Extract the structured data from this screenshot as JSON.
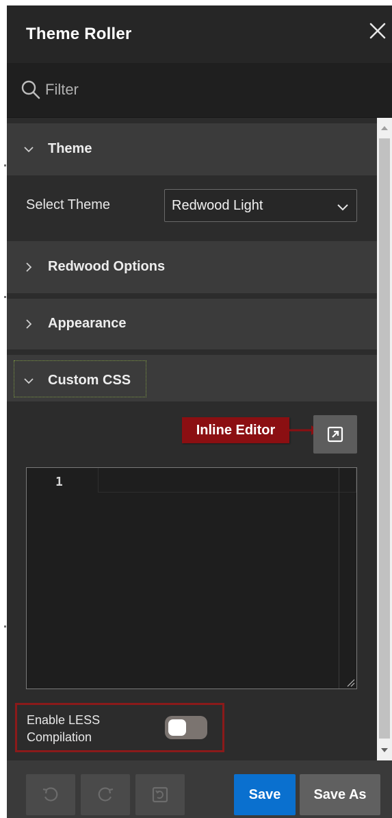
{
  "dialog": {
    "title": "Theme Roller",
    "close_icon": "close-icon"
  },
  "filter": {
    "placeholder": "Filter",
    "value": "",
    "icon": "search-icon"
  },
  "sections": {
    "theme": {
      "label": "Theme",
      "expanded": true
    },
    "redwood_options": {
      "label": "Redwood Options",
      "expanded": false
    },
    "appearance": {
      "label": "Appearance",
      "expanded": false
    },
    "custom_css": {
      "label": "Custom CSS",
      "expanded": true
    }
  },
  "theme_row": {
    "label": "Select Theme",
    "selected": "Redwood Light"
  },
  "custom_css": {
    "callout": "Inline Editor",
    "popout_icon": "open-in-new-icon",
    "editor": {
      "line_numbers": [
        "1"
      ],
      "content": ""
    },
    "less": {
      "label": "Enable LESS Compilation",
      "enabled": false
    }
  },
  "footer": {
    "undo_icon": "undo-icon",
    "redo_icon": "redo-icon",
    "reset_icon": "reset-icon",
    "save_label": "Save",
    "save_as_label": "Save As"
  },
  "colors": {
    "dialog_bg": "#2a2a2a",
    "section_header_bg": "#3b3b3b",
    "save_blue": "#0a70cf",
    "callout_red": "#8b0f12",
    "highlight_border": "#8b1a1a"
  }
}
